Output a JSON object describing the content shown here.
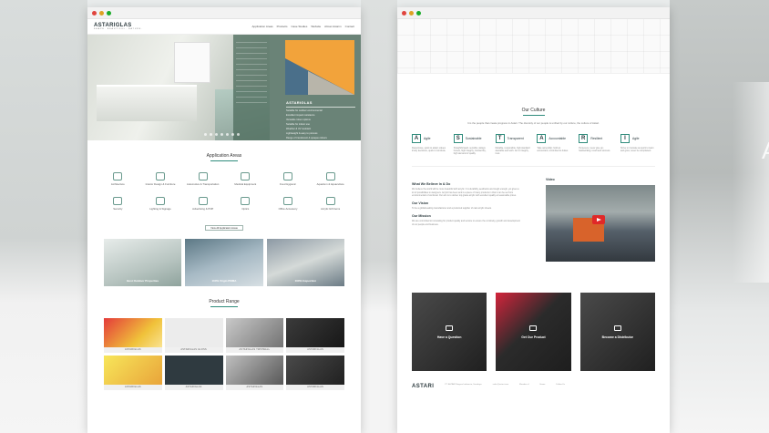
{
  "left_page": {
    "logo": "ASTARIGLAS",
    "logo_tagline": "SHAPE. BEAUTIFUL. NATURE.",
    "nav": [
      "Application Areas",
      "Products",
      "Case Studies",
      "Website",
      "Almac Astarm",
      "Contact"
    ],
    "hero_brand": "ASTARIGLAS",
    "hero_lines": [
      "Suitable for outdoor environmental",
      "Excellent impact resistance",
      "Versatile colour options",
      "Suitable for indoor use",
      "Weather & UV resistant",
      "Lightweight & easy to process",
      "Range of translucent & opaque colours"
    ],
    "application_title": "Application Areas",
    "applications": [
      "Architecture",
      "Interior Design & Furniture",
      "Automotive & Transportation",
      "Medical Equipment",
      "Food Hygienic",
      "Aquarium & Aquaculture",
      "Security",
      "Lighting & Signage",
      "Advertising & POP",
      "Optics",
      "Office Accessory",
      "Acrylic Gift Items"
    ],
    "view_all": "View All Application Areas",
    "photos": [
      {
        "caption": "Best Outdoor Properties"
      },
      {
        "caption": "100% Virgin PMMA"
      },
      {
        "caption": "100% Inspection"
      }
    ],
    "product_title": "Product Range",
    "products": [
      "ASTARIGLAS",
      "ASTARIGLAS GLOSS",
      "ASTARIGLAS TWINWALL",
      "ASTARIGLAS",
      "ASTARIGLAS",
      "ASTARIGLAS",
      "ASTARIGLAS",
      "ASTARIGLAS"
    ]
  },
  "right_page": {
    "culture_title": "Our Culture",
    "culture_sub": "It is the people that create progress in Astari. The diversity of our people is unified by our culture, the culture of Astari.",
    "values": [
      {
        "letter": "A",
        "name": "Agile",
        "desc": "Responsive, quick to adapt; values timely decisions, quick to conclude."
      },
      {
        "letter": "S",
        "name": "Sustainable",
        "desc": "Straightforward, sensible; always honest, high integrity; trustworthy, high demand of quality."
      },
      {
        "letter": "T",
        "name": "Transparent",
        "desc": "Reliable, responsible, high standard desirable and work. Act in integrity, trust."
      },
      {
        "letter": "A",
        "name": "Accountable",
        "desc": "Take ownership; hold an accountant; committed to duties."
      },
      {
        "letter": "R",
        "name": "Resilient",
        "desc": "Persevere; never give up; hardworking; result and success."
      },
      {
        "letter": "I",
        "name": "Agile",
        "desc": "Strive to innovate as quick to learn and grow; never be complacent."
      }
    ],
    "believe_title": "What We Believe In & Do",
    "believe_text": "We believe the world will be more beautiful with acrylic. It is durability, aesthetics and tough enough, yet gives a lot of possibilities to designers. Acrylic has been and is a piece of many products in that it can be set from environmental to functional. Our aim is to deliver top grade acrylic with excellent quality at reasonable prices.",
    "vision_title": "Our Vision",
    "vision_text": "To be a global-leading manufacturer and a preferred supplier of cast acrylic sheets.",
    "mission_title": "Our Mission",
    "mission_text": "We are committed to innovating for product quality and service to ensure the continuity, growth and development of our people and business.",
    "video_label": "Video",
    "cta": [
      "Have a Question",
      "Get Our Product",
      "Become a Distributor"
    ],
    "footer_logo": "ASTARI",
    "footer_cols": [
      "PT. ASTARI Niagara Indonesia, Surabaya",
      "sales@astari.com",
      "Member of",
      "Home",
      "Follow Us"
    ]
  },
  "side_letter": "A",
  "colors": {
    "accent": "#2f8c7c",
    "hero_panel": "#6a8377",
    "cta_red": "#d3243b"
  }
}
